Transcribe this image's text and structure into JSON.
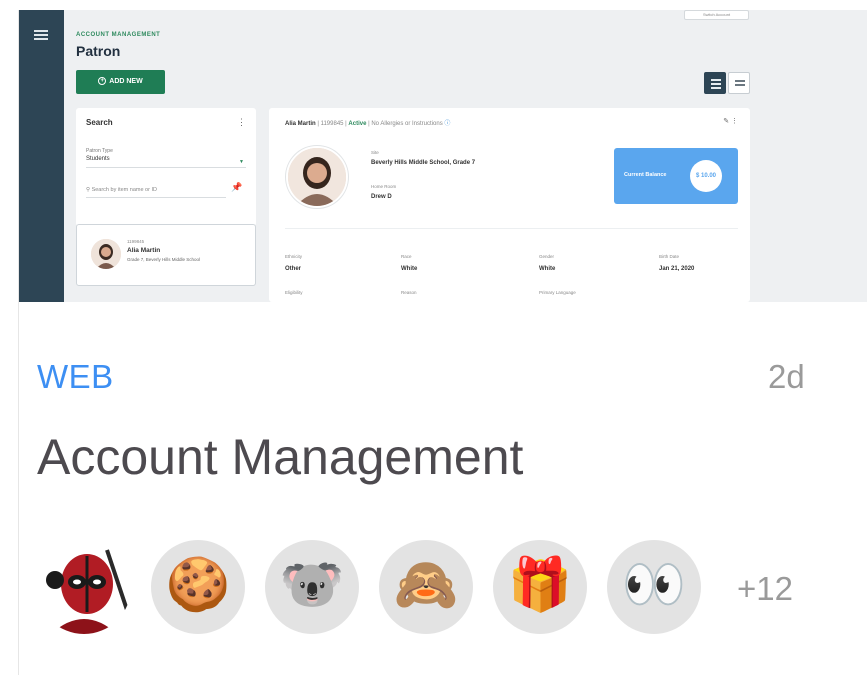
{
  "preview": {
    "top_chip": "Switch Account",
    "breadcrumb": "ACCOUNT MANAGEMENT",
    "page_title": "Patron",
    "add_button": "ADD NEW",
    "search_panel": {
      "title": "Search",
      "patron_type_label": "Patron Type",
      "patron_type_value": "Students",
      "search_placeholder": "Search by item name or ID"
    },
    "selected_patron": {
      "id": "1199845",
      "name": "Alia Martin",
      "subtitle": "Grade 7, Beverly Hills Middle School"
    },
    "detail": {
      "name": "Alia Martin",
      "id": "1199845",
      "status": "Active",
      "allergy_note": "No Allergies or Instructions",
      "site_label": "Site",
      "site_value": "Beverly Hills Middle School, Grade 7",
      "homeroom_label": "Home Room",
      "homeroom_value": "Drew D",
      "balance_label": "Current Balance",
      "balance_value": "$ 10.00",
      "fields": [
        {
          "label": "Ethnicity",
          "value": "Other"
        },
        {
          "label": "Race",
          "value": "White"
        },
        {
          "label": "Gender",
          "value": "White"
        },
        {
          "label": "Birth Date",
          "value": "Jan 21, 2020"
        },
        {
          "label": "Eligibility",
          "value": ""
        },
        {
          "label": "Reason",
          "value": ""
        },
        {
          "label": "Primary Language",
          "value": ""
        }
      ]
    }
  },
  "card": {
    "tag": "WEB",
    "age": "2d",
    "title": "Account Management",
    "more_count": "+12",
    "avatars": [
      {
        "name": "deadpool-avatar",
        "glyph": "🦸"
      },
      {
        "name": "cookie-avatar",
        "glyph": "🍪"
      },
      {
        "name": "koala-avatar",
        "glyph": "🐨"
      },
      {
        "name": "monkey-avatar",
        "glyph": "🙈"
      },
      {
        "name": "gift-avatar",
        "glyph": "🎁"
      },
      {
        "name": "eyes-avatar",
        "glyph": "👀"
      }
    ]
  },
  "colors": {
    "accent": "#3d8ff3",
    "rail": "#2d4555",
    "add_button": "#1f7d55",
    "balance": "#5aa6ee"
  }
}
